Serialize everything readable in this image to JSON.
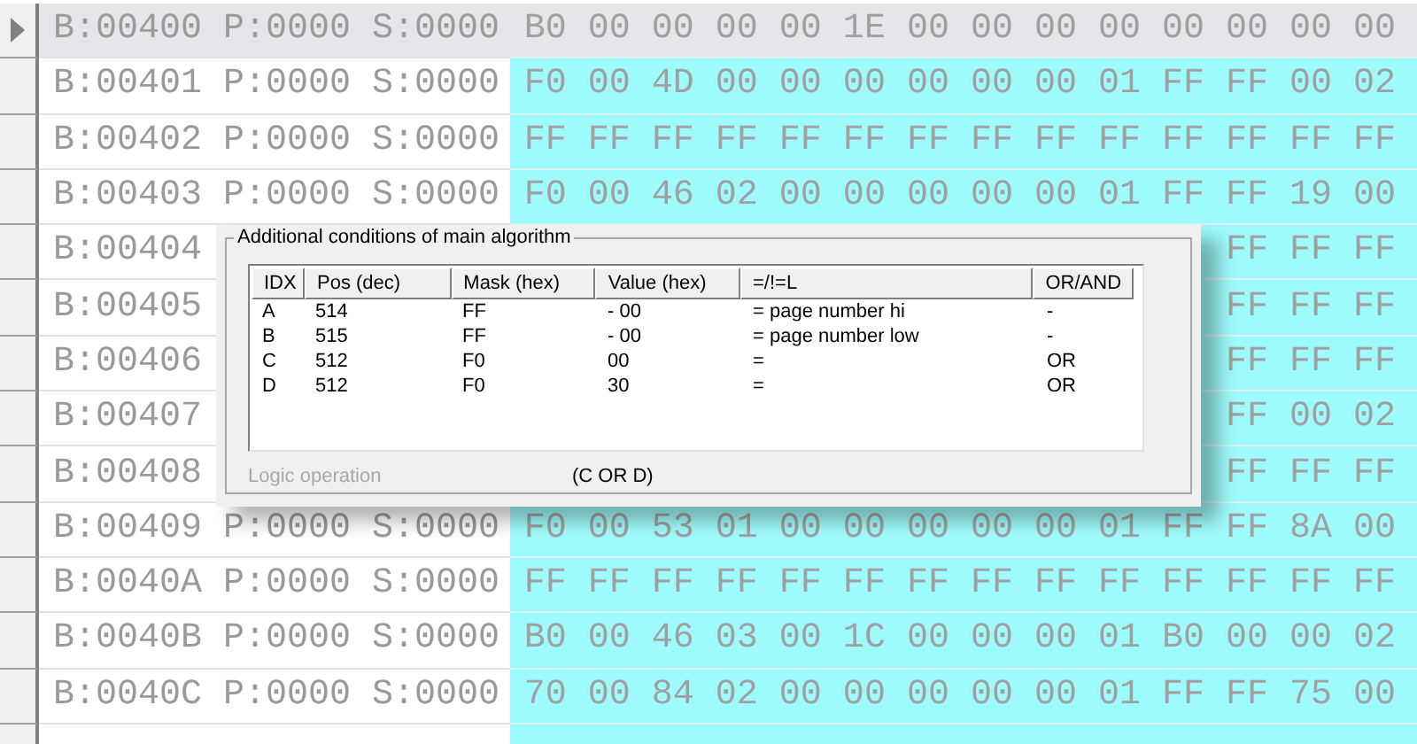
{
  "grid": {
    "rows": [
      {
        "address": "B:00400 P:0000 S:0000",
        "bytes": "B0 00 00 00 00 1E 00 00 00 00 00 00 00 00",
        "selected": true
      },
      {
        "address": "B:00401 P:0000 S:0000",
        "bytes": "F0 00 4D 00 00 00 00 00 00 01 FF FF 00 02",
        "selected": false
      },
      {
        "address": "B:00402 P:0000 S:0000",
        "bytes": "FF FF FF FF FF FF FF FF FF FF FF FF FF FF",
        "selected": false
      },
      {
        "address": "B:00403 P:0000 S:0000",
        "bytes": "F0 00 46 02 00 00 00 00 00 01 FF FF 19 00",
        "selected": false
      },
      {
        "address": "B:00404",
        "bytes": "FF FF FF",
        "selected": false
      },
      {
        "address": "B:00405",
        "bytes": "FF FF FF",
        "selected": false
      },
      {
        "address": "B:00406",
        "bytes": "FF FF FF",
        "selected": false
      },
      {
        "address": "B:00407",
        "bytes": "FF 00 02",
        "selected": false
      },
      {
        "address": "B:00408",
        "bytes": "FF FF FF",
        "selected": false
      },
      {
        "address": "B:00409 P:0000 S:0000",
        "bytes": "F0 00 53 01 00 00 00 00 00 01 FF FF 8A 00",
        "selected": false
      },
      {
        "address": "B:0040A P:0000 S:0000",
        "bytes": "FF FF FF FF FF FF FF FF FF FF FF FF FF FF",
        "selected": false
      },
      {
        "address": "B:0040B P:0000 S:0000",
        "bytes": "B0 00 46 03 00 1C 00 00 00 01 B0 00 00 02",
        "selected": false
      },
      {
        "address": "B:0040C P:0000 S:0000",
        "bytes": "70 00 84 02 00 00 00 00 00 01 FF FF 75 00",
        "selected": false
      }
    ]
  },
  "dialog": {
    "group_title": "Additional conditions of main algorithm",
    "columns": [
      "IDX",
      "Pos (dec)",
      "Mask (hex)",
      "Value (hex)",
      "=/!=L",
      "OR/AND"
    ],
    "rows": [
      [
        "A",
        "514",
        "FF",
        "- 00",
        "= page number hi",
        "-"
      ],
      [
        "B",
        "515",
        "FF",
        "- 00",
        "= page number low",
        "-"
      ],
      [
        "C",
        "512",
        "F0",
        "00",
        "=",
        "OR"
      ],
      [
        "D",
        "512",
        "F0",
        "30",
        "=",
        "OR"
      ]
    ],
    "logic_operation": {
      "label": "Logic operation",
      "value": "(C OR D)",
      "disabled": true
    }
  }
}
